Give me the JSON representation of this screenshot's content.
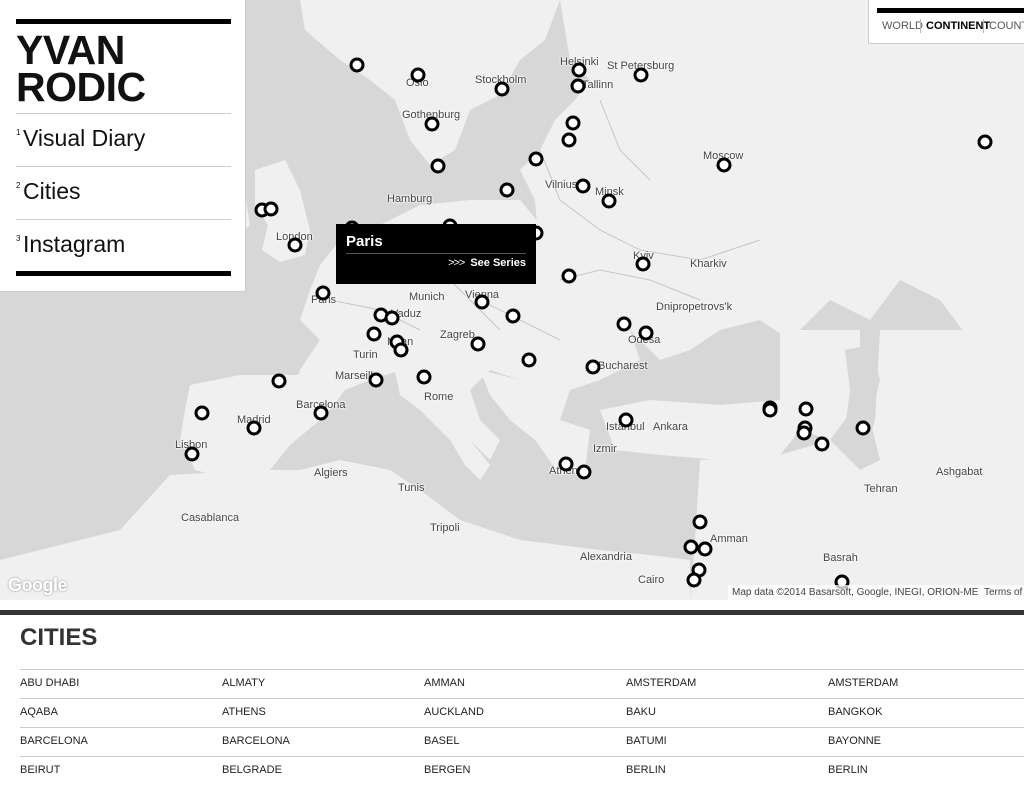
{
  "brand": {
    "name_line1": "YVAN",
    "name_line2": "RODIC",
    "nav": [
      {
        "num": "1",
        "label": "Visual Diary"
      },
      {
        "num": "2",
        "label": "Cities"
      },
      {
        "num": "3",
        "label": "Instagram"
      }
    ]
  },
  "view_tabs": {
    "world": "WORLD",
    "continent": "CONTINENT",
    "country": "COUNTRY",
    "active": "CONTINENT"
  },
  "tooltip": {
    "city": "Paris",
    "arrow": ">>>",
    "cta": "See Series"
  },
  "map": {
    "logo": "Google",
    "attribution": "Map data ©2014 Basarsoft, Google, INEGI, ORION-ME",
    "terms": "Terms of Use",
    "labels": {
      "oslo": "Oslo",
      "stockholm": "Stockholm",
      "helsinki": "Helsinki",
      "st_petersburg": "St Petersburg",
      "tallinn": "Tallinn",
      "gothenburg": "Gothenburg",
      "moscow": "Moscow",
      "vilnius": "Vilnius",
      "minsk": "Minsk",
      "hamburg": "Hamburg",
      "london": "London",
      "kyiv": "Kyiv",
      "kharkiv": "Kharkiv",
      "paris": "Paris",
      "munich": "Munich",
      "vienna": "Vienna",
      "vaduz": "Vaduz",
      "dnipropetrovsk": "Dnipropetrovs'k",
      "zagreb": "Zagreb",
      "milan": "Milan",
      "odesa": "Odesa",
      "turin": "Turin",
      "bucharest": "Bucharest",
      "marseille": "Marseille",
      "rome": "Rome",
      "barcelona": "Barcelona",
      "madrid": "Madrid",
      "istanbul": "Istanbul",
      "ankara": "Ankara",
      "lisbon": "Lisbon",
      "izmir": "Izmir",
      "algiers": "Algiers",
      "athens": "Athens",
      "tunis": "Tunis",
      "ashgabat": "Ashgabat",
      "tehran": "Tehran",
      "casablanca": "Casablanca",
      "tripoli": "Tripoli",
      "amman": "Amman",
      "alexandria": "Alexandria",
      "basrah": "Basrah",
      "cairo": "Cairo"
    }
  },
  "cities": {
    "title": "CITIES",
    "rows": [
      [
        "ABU DHABI",
        "ALMATY",
        "AMMAN",
        "AMSTERDAM",
        "AMSTERDAM"
      ],
      [
        "AQABA",
        "ATHENS",
        "AUCKLAND",
        "BAKU",
        "BANGKOK"
      ],
      [
        "BARCELONA",
        "BARCELONA",
        "BASEL",
        "BATUMI",
        "BAYONNE"
      ],
      [
        "BEIRUT",
        "BELGRADE",
        "BERGEN",
        "BERLIN",
        "BERLIN"
      ]
    ]
  }
}
